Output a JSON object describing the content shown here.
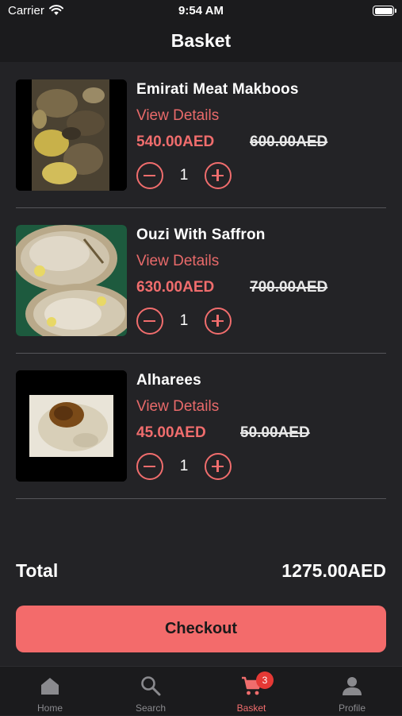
{
  "status_bar": {
    "carrier": "Carrier",
    "time": "9:54 AM"
  },
  "header": {
    "title": "Basket"
  },
  "items": [
    {
      "name": "Emirati Meat Makboos",
      "details_link": "View Details",
      "price": "540.00AED",
      "old_price": "600.00AED",
      "quantity": "1"
    },
    {
      "name": "Ouzi With Saffron",
      "details_link": "View Details",
      "price": "630.00AED",
      "old_price": "700.00AED",
      "quantity": "1"
    },
    {
      "name": "Alharees",
      "details_link": "View Details",
      "price": "45.00AED",
      "old_price": "50.00AED",
      "quantity": "1"
    }
  ],
  "summary": {
    "total_label": "Total",
    "total_value": "1275.00AED"
  },
  "checkout": {
    "label": "Checkout"
  },
  "tabs": [
    {
      "label": "Home",
      "icon": "home-icon"
    },
    {
      "label": "Search",
      "icon": "search-icon"
    },
    {
      "label": "Basket",
      "icon": "cart-icon",
      "badge": "3",
      "active": true
    },
    {
      "label": "Profile",
      "icon": "person-icon"
    }
  ],
  "colors": {
    "accent": "#f36b6b",
    "background": "#232326",
    "bar": "#1b1b1d",
    "badge": "#e53935"
  }
}
